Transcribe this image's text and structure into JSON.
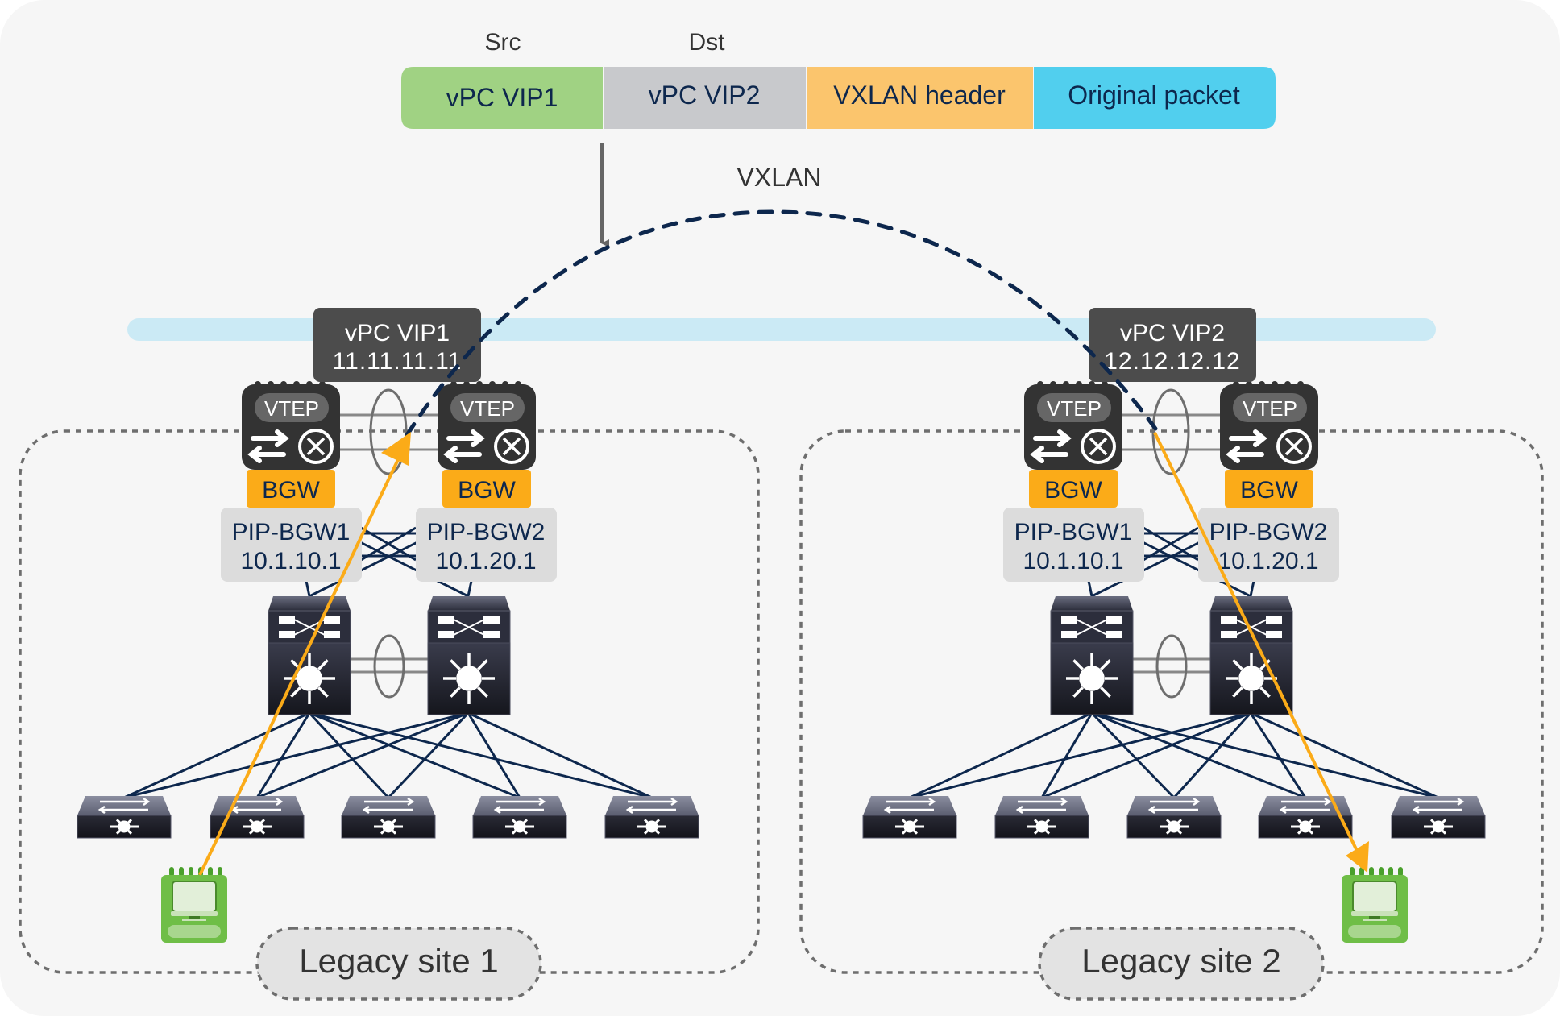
{
  "header": {
    "src_label": "Src",
    "dst_label": "Dst"
  },
  "packet": {
    "segments": [
      {
        "label": "vPC VIP1",
        "color": "#a0d283"
      },
      {
        "label": "vPC VIP2",
        "color": "#c8c9cc"
      },
      {
        "label": "VXLAN header",
        "color": "#fbc56d"
      },
      {
        "label": "Original packet",
        "color": "#51cfee"
      }
    ]
  },
  "tunnel": {
    "label": "VXLAN"
  },
  "sites": [
    {
      "name": "Legacy site 1",
      "vip": {
        "title": "vPC VIP1",
        "ip": "11.11.11.11"
      },
      "vteps": [
        {
          "badge": "VTEP",
          "role": "BGW",
          "pip_name": "PIP-BGW1",
          "pip_ip": "10.1.10.1"
        },
        {
          "badge": "VTEP",
          "role": "BGW",
          "pip_name": "PIP-BGW2",
          "pip_ip": "10.1.20.1"
        }
      ]
    },
    {
      "name": "Legacy site 2",
      "vip": {
        "title": "vPC VIP2",
        "ip": "12.12.12.12"
      },
      "vteps": [
        {
          "badge": "VTEP",
          "role": "BGW",
          "pip_name": "PIP-BGW1",
          "pip_ip": "10.1.10.1"
        },
        {
          "badge": "VTEP",
          "role": "BGW",
          "pip_name": "PIP-BGW2",
          "pip_ip": "10.1.20.1"
        }
      ]
    }
  ],
  "colors": {
    "background": "#f6f6f6",
    "transport_band": "#cbeaf5",
    "vip_box": "#4c4c4c",
    "vtep_body": "#333333",
    "bgw": "#fbab18",
    "pip_box": "#dcdcdc",
    "traffic_path": "#fbab18",
    "tunnel_line": "#0d274d",
    "link_line": "#0d274d",
    "host": "#6fbe47",
    "text_dark": "#0d274d"
  },
  "icons": {
    "vtep": "vtep-router-icon",
    "spine": "layer3-switch-icon",
    "leaf": "nexus-switch-icon",
    "host": "workstation-icon"
  }
}
